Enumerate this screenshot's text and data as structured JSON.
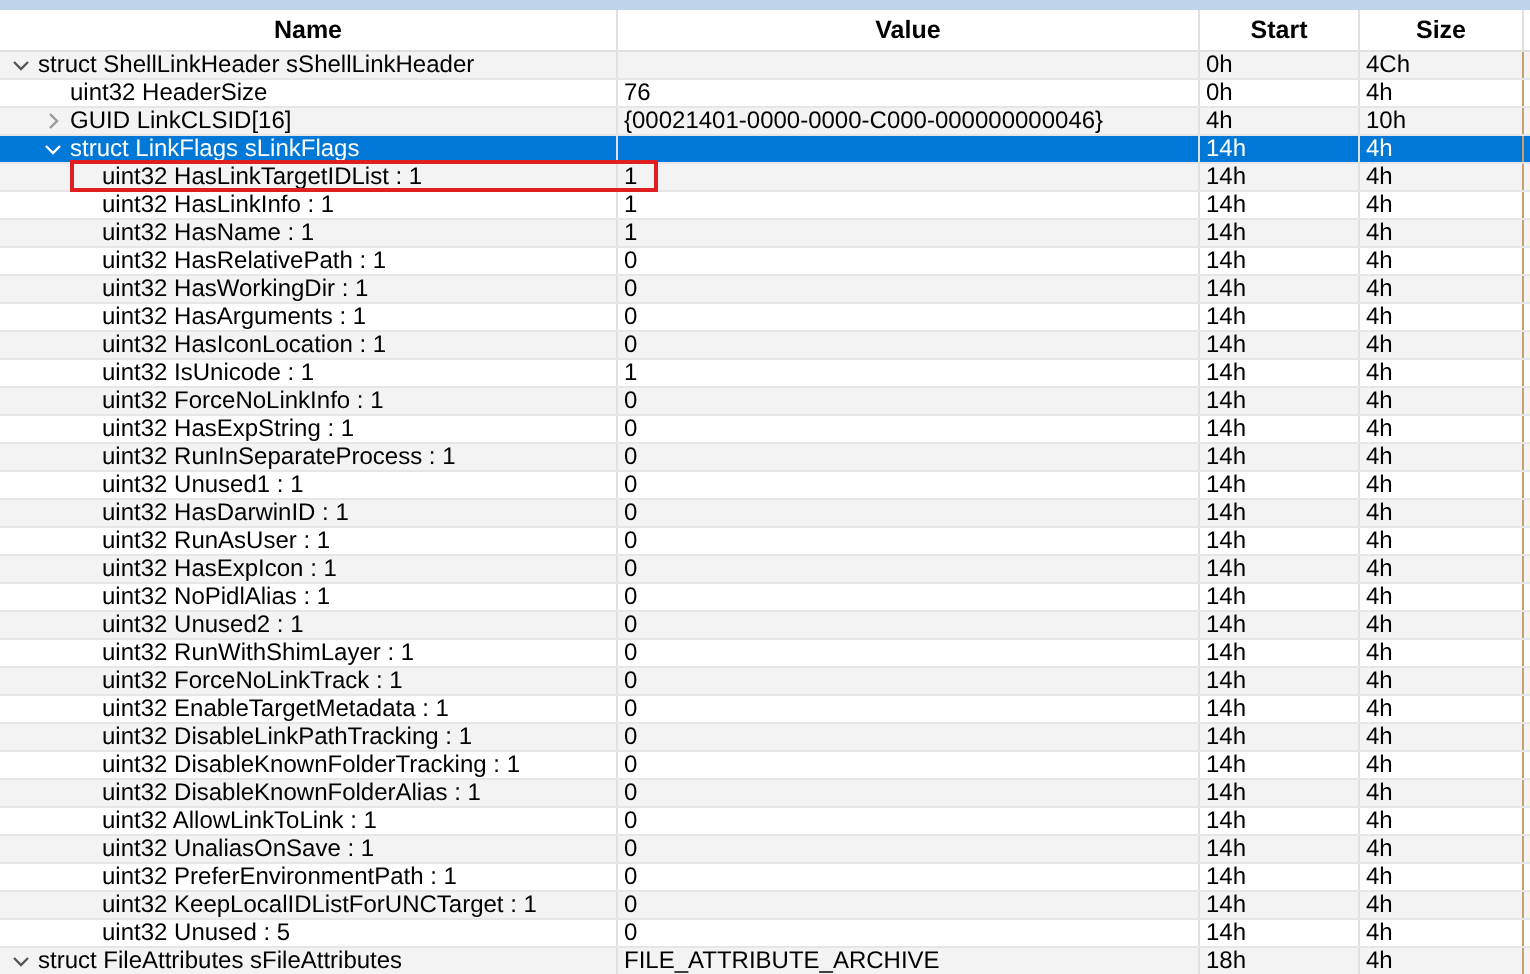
{
  "columns": [
    "Name",
    "Value",
    "Start",
    "Size"
  ],
  "rows": [
    {
      "name": "struct ShellLinkHeader sShellLinkHeader",
      "start": "0h",
      "size": "4Ch",
      "expanded": true,
      "selected": false,
      "highlighted": false,
      "children": [
        {
          "name": "uint32 HeaderSize",
          "value": "76",
          "start": "0h",
          "size": "4h",
          "selected": false,
          "highlighted": false
        },
        {
          "name": "GUID LinkCLSID[16]",
          "value": "{00021401-0000-0000-C000-000000000046}",
          "start": "4h",
          "size": "10h",
          "expanded": false,
          "selected": false,
          "highlighted": false
        },
        {
          "name": "struct LinkFlags sLinkFlags",
          "start": "14h",
          "size": "4h",
          "expanded": true,
          "selected": true,
          "highlighted": false,
          "children": [
            {
              "name": "uint32 HasLinkTargetIDList : 1",
              "value": "1",
              "start": "14h",
              "size": "4h",
              "selected": false,
              "highlighted": true
            },
            {
              "name": "uint32 HasLinkInfo : 1",
              "value": "1",
              "start": "14h",
              "size": "4h",
              "selected": false,
              "highlighted": false
            },
            {
              "name": "uint32 HasName : 1",
              "value": "1",
              "start": "14h",
              "size": "4h",
              "selected": false,
              "highlighted": false
            },
            {
              "name": "uint32 HasRelativePath : 1",
              "value": "0",
              "start": "14h",
              "size": "4h",
              "selected": false,
              "highlighted": false
            },
            {
              "name": "uint32 HasWorkingDir : 1",
              "value": "0",
              "start": "14h",
              "size": "4h",
              "selected": false,
              "highlighted": false
            },
            {
              "name": "uint32 HasArguments : 1",
              "value": "0",
              "start": "14h",
              "size": "4h",
              "selected": false,
              "highlighted": false
            },
            {
              "name": "uint32 HasIconLocation : 1",
              "value": "0",
              "start": "14h",
              "size": "4h",
              "selected": false,
              "highlighted": false
            },
            {
              "name": "uint32 IsUnicode : 1",
              "value": "1",
              "start": "14h",
              "size": "4h",
              "selected": false,
              "highlighted": false
            },
            {
              "name": "uint32 ForceNoLinkInfo : 1",
              "value": "0",
              "start": "14h",
              "size": "4h",
              "selected": false,
              "highlighted": false
            },
            {
              "name": "uint32 HasExpString : 1",
              "value": "0",
              "start": "14h",
              "size": "4h",
              "selected": false,
              "highlighted": false
            },
            {
              "name": "uint32 RunInSeparateProcess : 1",
              "value": "0",
              "start": "14h",
              "size": "4h",
              "selected": false,
              "highlighted": false
            },
            {
              "name": "uint32 Unused1 : 1",
              "value": "0",
              "start": "14h",
              "size": "4h",
              "selected": false,
              "highlighted": false
            },
            {
              "name": "uint32 HasDarwinID : 1",
              "value": "0",
              "start": "14h",
              "size": "4h",
              "selected": false,
              "highlighted": false
            },
            {
              "name": "uint32 RunAsUser : 1",
              "value": "0",
              "start": "14h",
              "size": "4h",
              "selected": false,
              "highlighted": false
            },
            {
              "name": "uint32 HasExpIcon : 1",
              "value": "0",
              "start": "14h",
              "size": "4h",
              "selected": false,
              "highlighted": false
            },
            {
              "name": "uint32 NoPidlAlias : 1",
              "value": "0",
              "start": "14h",
              "size": "4h",
              "selected": false,
              "highlighted": false
            },
            {
              "name": "uint32 Unused2 : 1",
              "value": "0",
              "start": "14h",
              "size": "4h",
              "selected": false,
              "highlighted": false
            },
            {
              "name": "uint32 RunWithShimLayer : 1",
              "value": "0",
              "start": "14h",
              "size": "4h",
              "selected": false,
              "highlighted": false
            },
            {
              "name": "uint32 ForceNoLinkTrack : 1",
              "value": "0",
              "start": "14h",
              "size": "4h",
              "selected": false,
              "highlighted": false
            },
            {
              "name": "uint32 EnableTargetMetadata : 1",
              "value": "0",
              "start": "14h",
              "size": "4h",
              "selected": false,
              "highlighted": false
            },
            {
              "name": "uint32 DisableLinkPathTracking : 1",
              "value": "0",
              "start": "14h",
              "size": "4h",
              "selected": false,
              "highlighted": false
            },
            {
              "name": "uint32 DisableKnownFolderTracking : 1",
              "value": "0",
              "start": "14h",
              "size": "4h",
              "selected": false,
              "highlighted": false
            },
            {
              "name": "uint32 DisableKnownFolderAlias : 1",
              "value": "0",
              "start": "14h",
              "size": "4h",
              "selected": false,
              "highlighted": false
            },
            {
              "name": "uint32 AllowLinkToLink : 1",
              "value": "0",
              "start": "14h",
              "size": "4h",
              "selected": false,
              "highlighted": false
            },
            {
              "name": "uint32 UnaliasOnSave : 1",
              "value": "0",
              "start": "14h",
              "size": "4h",
              "selected": false,
              "highlighted": false
            },
            {
              "name": "uint32 PreferEnvironmentPath : 1",
              "value": "0",
              "start": "14h",
              "size": "4h",
              "selected": false,
              "highlighted": false
            },
            {
              "name": "uint32 KeepLocalIDListForUNCTarget : 1",
              "value": "0",
              "start": "14h",
              "size": "4h",
              "selected": false,
              "highlighted": false
            },
            {
              "name": "uint32 Unused : 5",
              "value": "0",
              "start": "14h",
              "size": "4h",
              "selected": false,
              "highlighted": false
            }
          ]
        }
      ]
    },
    {
      "name": "struct FileAttributes sFileAttributes",
      "value": "FILE_ATTRIBUTE_ARCHIVE",
      "start": "18h",
      "size": "4h",
      "expanded": true,
      "selected": false,
      "highlighted": false
    }
  ]
}
